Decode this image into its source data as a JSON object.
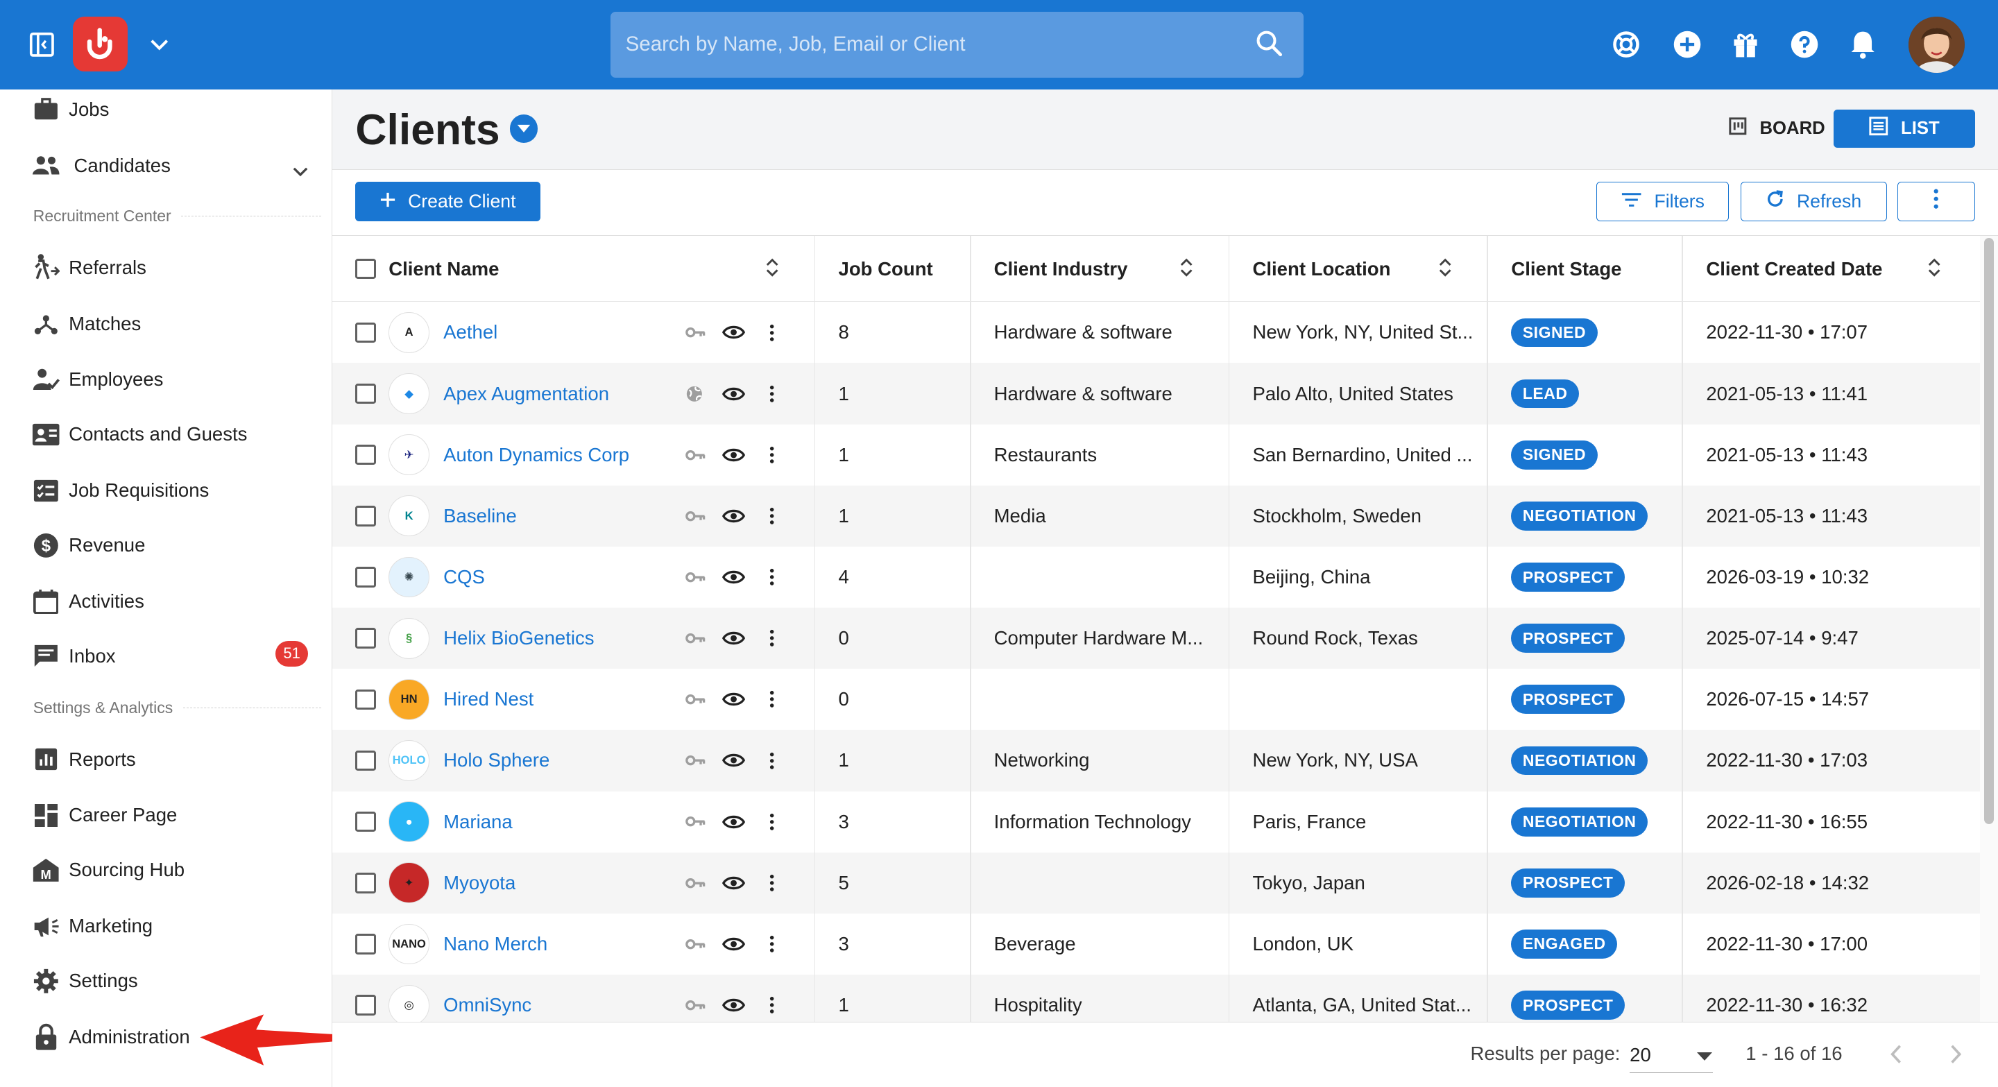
{
  "topbar": {
    "search_placeholder": "Search by Name, Job, Email or Client",
    "icons": [
      "sidebar-toggle-icon",
      "app-logo",
      "chevron-down-icon",
      "search-icon",
      "settings-icon",
      "add-icon",
      "gift-icon",
      "help-icon",
      "bell-icon",
      "avatar"
    ]
  },
  "sidebar": {
    "items_top": [
      {
        "label": "Jobs",
        "icon": "briefcase-icon"
      },
      {
        "label": "Candidates",
        "icon": "people-icon"
      }
    ],
    "section1": "Recruitment Center",
    "items_mid": [
      {
        "label": "Referrals",
        "icon": "referral-icon"
      },
      {
        "label": "Matches",
        "icon": "matches-icon"
      },
      {
        "label": "Employees",
        "icon": "employee-icon"
      },
      {
        "label": "Contacts and Guests",
        "icon": "contacts-icon"
      },
      {
        "label": "Job Requisitions",
        "icon": "requisition-icon"
      },
      {
        "label": "Revenue",
        "icon": "dollar-icon"
      },
      {
        "label": "Activities",
        "icon": "calendar-icon"
      },
      {
        "label": "Inbox",
        "icon": "inbox-icon",
        "badge": "51"
      }
    ],
    "section2": "Settings & Analytics",
    "items_bottom": [
      {
        "label": "Reports",
        "icon": "reports-icon"
      },
      {
        "label": "Career Page",
        "icon": "career-page-icon"
      },
      {
        "label": "Sourcing Hub",
        "icon": "sourcing-hub-icon"
      },
      {
        "label": "Marketing",
        "icon": "megaphone-icon"
      },
      {
        "label": "Settings",
        "icon": "gear-icon"
      },
      {
        "label": "Administration",
        "icon": "lock-icon"
      }
    ]
  },
  "main": {
    "title": "Clients",
    "view_board": "BOARD",
    "view_list": "LIST",
    "create_button": "Create Client",
    "filters_button": "Filters",
    "refresh_button": "Refresh"
  },
  "table": {
    "headers": [
      "Client Name",
      "Job Count",
      "Client Industry",
      "Client Location",
      "Client Stage",
      "Client Created Date"
    ],
    "rows": [
      {
        "name": "Aethel",
        "jobs": "8",
        "industry": "Hardware & software",
        "location": "New York, NY, United St...",
        "stage": "SIGNED",
        "created": "2022-11-30 • 17:07",
        "access": "key",
        "logo_bg": "#ffffff",
        "logo_fg": "#212121",
        "logo_text": "A"
      },
      {
        "name": "Apex Augmentation",
        "jobs": "1",
        "industry": "Hardware & software",
        "location": "Palo Alto, United States",
        "stage": "LEAD",
        "created": "2021-05-13 • 11:41",
        "access": "globe",
        "logo_bg": "#ffffff",
        "logo_fg": "#1e88e5",
        "logo_text": "◆"
      },
      {
        "name": "Auton Dynamics Corp",
        "jobs": "1",
        "industry": "Restaurants",
        "location": "San Bernardino, United ...",
        "stage": "SIGNED",
        "created": "2021-05-13 • 11:43",
        "access": "key",
        "logo_bg": "#ffffff",
        "logo_fg": "#1a237e",
        "logo_text": "✈"
      },
      {
        "name": "Baseline",
        "jobs": "1",
        "industry": "Media",
        "location": "Stockholm, Sweden",
        "stage": "NEGOTIATION",
        "created": "2021-05-13 • 11:43",
        "access": "key",
        "logo_bg": "#ffffff",
        "logo_fg": "#00838f",
        "logo_text": "K"
      },
      {
        "name": "CQS",
        "jobs": "4",
        "industry": "",
        "location": "Beijing, China",
        "stage": "PROSPECT",
        "created": "2026-03-19 • 10:32",
        "access": "key",
        "logo_bg": "#e3f2fd",
        "logo_fg": "#37474f",
        "logo_text": "✺"
      },
      {
        "name": "Helix BioGenetics",
        "jobs": "0",
        "industry": "Computer Hardware M...",
        "location": "Round Rock, Texas",
        "stage": "PROSPECT",
        "created": "2025-07-14 • 9:47",
        "access": "key",
        "logo_bg": "#ffffff",
        "logo_fg": "#43a047",
        "logo_text": "§"
      },
      {
        "name": "Hired Nest",
        "jobs": "0",
        "industry": "",
        "location": "",
        "stage": "PROSPECT",
        "created": "2026-07-15 • 14:57",
        "access": "key",
        "logo_bg": "#f9a825",
        "logo_fg": "#212121",
        "logo_text": "HN"
      },
      {
        "name": "Holo Sphere",
        "jobs": "1",
        "industry": "Networking",
        "location": "New York, NY, USA",
        "stage": "NEGOTIATION",
        "created": "2022-11-30 • 17:03",
        "access": "key",
        "logo_bg": "#ffffff",
        "logo_fg": "#4fc3f7",
        "logo_text": "HOLO"
      },
      {
        "name": "Mariana",
        "jobs": "3",
        "industry": "Information Technology",
        "location": "Paris, France",
        "stage": "NEGOTIATION",
        "created": "2022-11-30 • 16:55",
        "access": "key",
        "logo_bg": "#29b6f6",
        "logo_fg": "#ffffff",
        "logo_text": "●"
      },
      {
        "name": "Myoyota",
        "jobs": "5",
        "industry": "",
        "location": "Tokyo, Japan",
        "stage": "PROSPECT",
        "created": "2026-02-18 • 14:32",
        "access": "key",
        "logo_bg": "#c62828",
        "logo_fg": "#212121",
        "logo_text": "✦"
      },
      {
        "name": "Nano Merch",
        "jobs": "3",
        "industry": "Beverage",
        "location": "London, UK",
        "stage": "ENGAGED",
        "created": "2022-11-30 • 17:00",
        "access": "key",
        "logo_bg": "#ffffff",
        "logo_fg": "#212121",
        "logo_text": "NANO"
      },
      {
        "name": "OmniSync",
        "jobs": "1",
        "industry": "Hospitality",
        "location": "Atlanta, GA, United Stat...",
        "stage": "PROSPECT",
        "created": "2022-11-30 • 16:32",
        "access": "key",
        "logo_bg": "#ffffff",
        "logo_fg": "#212121",
        "logo_text": "◎"
      }
    ]
  },
  "footer": {
    "results_per_page_label": "Results per page:",
    "results_per_page_value": "20",
    "range": "1 - 16 of 16"
  },
  "colors": {
    "brand_blue": "#1976d2",
    "logo_red": "#e53935",
    "annotation_arrow": "#e8231a"
  }
}
